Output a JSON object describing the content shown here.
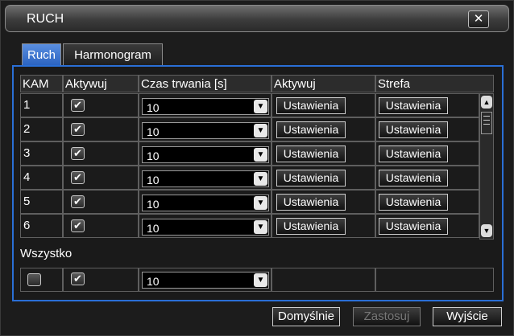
{
  "window": {
    "title": "RUCH",
    "close_symbol": "✕"
  },
  "tabs": [
    {
      "label": "Ruch",
      "active": true
    },
    {
      "label": "Harmonogram",
      "active": false
    }
  ],
  "table": {
    "headers": [
      "KAM",
      "Aktywuj",
      "Czas trwania [s]",
      "Aktywuj",
      "Strefa"
    ],
    "rows": [
      {
        "cam": "1",
        "enabled": true,
        "duration": "10",
        "alarm_btn": "Ustawienia",
        "zone_btn": "Ustawienia"
      },
      {
        "cam": "2",
        "enabled": true,
        "duration": "10",
        "alarm_btn": "Ustawienia",
        "zone_btn": "Ustawienia"
      },
      {
        "cam": "3",
        "enabled": true,
        "duration": "10",
        "alarm_btn": "Ustawienia",
        "zone_btn": "Ustawienia"
      },
      {
        "cam": "4",
        "enabled": true,
        "duration": "10",
        "alarm_btn": "Ustawienia",
        "zone_btn": "Ustawienia"
      },
      {
        "cam": "5",
        "enabled": true,
        "duration": "10",
        "alarm_btn": "Ustawienia",
        "zone_btn": "Ustawienia"
      },
      {
        "cam": "6",
        "enabled": true,
        "duration": "10",
        "alarm_btn": "Ustawienia",
        "zone_btn": "Ustawienia"
      }
    ]
  },
  "all_row": {
    "label": "Wszystko",
    "select_all": false,
    "enabled": true,
    "duration": "10"
  },
  "footer": {
    "default_label": "Domyślnie",
    "apply_label": "Zastosuj",
    "exit_label": "Wyjście"
  },
  "colors": {
    "accent": "#2a6fd6",
    "disabled_text": "#777777"
  },
  "icons": {
    "check": "✔",
    "dropdown": "▼",
    "scroll_up": "▲",
    "scroll_down": "▼"
  }
}
